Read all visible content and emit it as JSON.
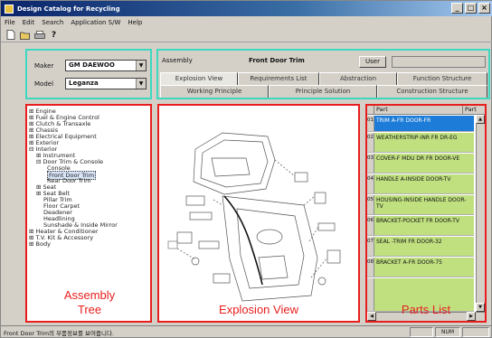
{
  "window": {
    "title": "Design Catalog for Recycling"
  },
  "menu": [
    "File",
    "Edit",
    "Search",
    "Application S/W",
    "Help"
  ],
  "toolbar": {
    "icons": [
      "new-icon",
      "open-icon",
      "print-icon",
      "help-icon"
    ],
    "help_glyph": "?"
  },
  "selector": {
    "maker_label": "Maker",
    "maker_value": "GM DAEWOO",
    "model_label": "Model",
    "model_value": "Leganza"
  },
  "assembly": {
    "label": "Assembly",
    "name": "Front Door Trim",
    "user_button": "User",
    "tabs_row1": [
      "Explosion View",
      "Requirements List",
      "Abstraction",
      "Function Structure"
    ],
    "tabs_row2": [
      "Working Principle",
      "Principle Solution",
      "Construction Structure"
    ]
  },
  "tree": {
    "items": [
      "Engine",
      "Fuel & Engine Control",
      "Clutch & Transaxle",
      "Chassis",
      "Electrical Equipment",
      "Exterior",
      "Interior",
      "Instrument",
      "Door Trim & Console",
      "Console",
      "Front Door Trim",
      "Rear Door Trim",
      "Seat",
      "Seat Belt",
      "Pillar Trim",
      "Floor Carpet",
      "Deadener",
      "Headlining",
      "Sunshade & Inside Mirror",
      "Heater & Conditioner",
      "T.V. Kit & Accessory",
      "Body"
    ]
  },
  "parts": {
    "col_part": "Part",
    "col_part2": "Part",
    "rows": [
      {
        "num": "01",
        "name": "TRIM A-FR DOOR-FR"
      },
      {
        "num": "02",
        "name": "WEATHERSTRIP-INR FR DR-EG"
      },
      {
        "num": "03",
        "name": "COVER-F MDU DR FR DOOR-VE"
      },
      {
        "num": "04",
        "name": "HANDLE A-INSIDE DOOR-TV"
      },
      {
        "num": "05",
        "name": "HOUSING-INSIDE HANDLE DOOR-TV"
      },
      {
        "num": "06",
        "name": "BRACKET-POCKET FR DOOR-TV"
      },
      {
        "num": "07",
        "name": "SEAL -TRIM FR DOOR-32"
      },
      {
        "num": "08",
        "name": "BRACKET A-FR DOOR-75"
      }
    ]
  },
  "captions": {
    "tree": "Assembly\nTree",
    "view": "Explosion View",
    "parts": "Parts List"
  },
  "status": {
    "text": "Front Door Trim의 부품정보를 보여줍니다.",
    "num": "NUM"
  },
  "colors": {
    "selector_border": "#3ed8c0",
    "panel_border": "#e81e1e",
    "part_bg": "#c0e080",
    "part_selected": "#1c7cd8"
  }
}
